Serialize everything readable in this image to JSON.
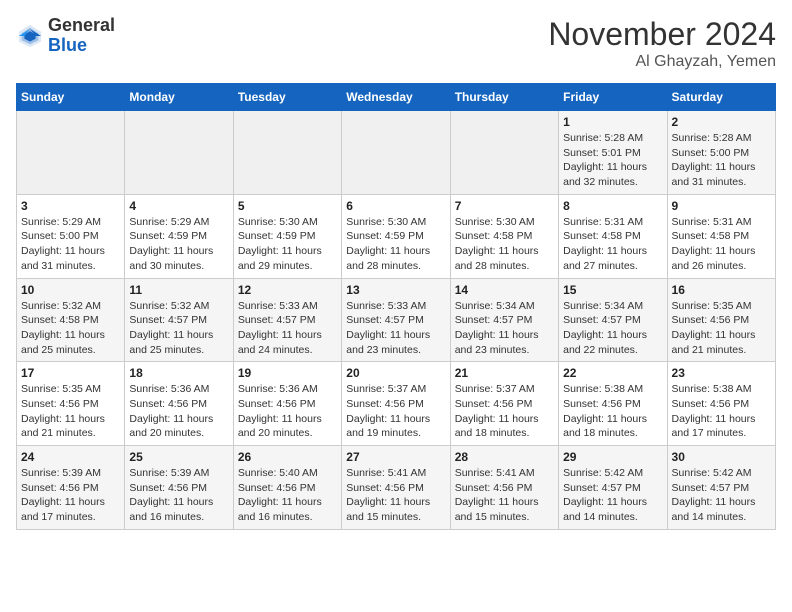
{
  "header": {
    "logo_line1": "General",
    "logo_line2": "Blue",
    "month": "November 2024",
    "location": "Al Ghayzah, Yemen"
  },
  "weekdays": [
    "Sunday",
    "Monday",
    "Tuesday",
    "Wednesday",
    "Thursday",
    "Friday",
    "Saturday"
  ],
  "weeks": [
    [
      {
        "day": "",
        "info": ""
      },
      {
        "day": "",
        "info": ""
      },
      {
        "day": "",
        "info": ""
      },
      {
        "day": "",
        "info": ""
      },
      {
        "day": "",
        "info": ""
      },
      {
        "day": "1",
        "info": "Sunrise: 5:28 AM\nSunset: 5:01 PM\nDaylight: 11 hours\nand 32 minutes."
      },
      {
        "day": "2",
        "info": "Sunrise: 5:28 AM\nSunset: 5:00 PM\nDaylight: 11 hours\nand 31 minutes."
      }
    ],
    [
      {
        "day": "3",
        "info": "Sunrise: 5:29 AM\nSunset: 5:00 PM\nDaylight: 11 hours\nand 31 minutes."
      },
      {
        "day": "4",
        "info": "Sunrise: 5:29 AM\nSunset: 4:59 PM\nDaylight: 11 hours\nand 30 minutes."
      },
      {
        "day": "5",
        "info": "Sunrise: 5:30 AM\nSunset: 4:59 PM\nDaylight: 11 hours\nand 29 minutes."
      },
      {
        "day": "6",
        "info": "Sunrise: 5:30 AM\nSunset: 4:59 PM\nDaylight: 11 hours\nand 28 minutes."
      },
      {
        "day": "7",
        "info": "Sunrise: 5:30 AM\nSunset: 4:58 PM\nDaylight: 11 hours\nand 28 minutes."
      },
      {
        "day": "8",
        "info": "Sunrise: 5:31 AM\nSunset: 4:58 PM\nDaylight: 11 hours\nand 27 minutes."
      },
      {
        "day": "9",
        "info": "Sunrise: 5:31 AM\nSunset: 4:58 PM\nDaylight: 11 hours\nand 26 minutes."
      }
    ],
    [
      {
        "day": "10",
        "info": "Sunrise: 5:32 AM\nSunset: 4:58 PM\nDaylight: 11 hours\nand 25 minutes."
      },
      {
        "day": "11",
        "info": "Sunrise: 5:32 AM\nSunset: 4:57 PM\nDaylight: 11 hours\nand 25 minutes."
      },
      {
        "day": "12",
        "info": "Sunrise: 5:33 AM\nSunset: 4:57 PM\nDaylight: 11 hours\nand 24 minutes."
      },
      {
        "day": "13",
        "info": "Sunrise: 5:33 AM\nSunset: 4:57 PM\nDaylight: 11 hours\nand 23 minutes."
      },
      {
        "day": "14",
        "info": "Sunrise: 5:34 AM\nSunset: 4:57 PM\nDaylight: 11 hours\nand 23 minutes."
      },
      {
        "day": "15",
        "info": "Sunrise: 5:34 AM\nSunset: 4:57 PM\nDaylight: 11 hours\nand 22 minutes."
      },
      {
        "day": "16",
        "info": "Sunrise: 5:35 AM\nSunset: 4:56 PM\nDaylight: 11 hours\nand 21 minutes."
      }
    ],
    [
      {
        "day": "17",
        "info": "Sunrise: 5:35 AM\nSunset: 4:56 PM\nDaylight: 11 hours\nand 21 minutes."
      },
      {
        "day": "18",
        "info": "Sunrise: 5:36 AM\nSunset: 4:56 PM\nDaylight: 11 hours\nand 20 minutes."
      },
      {
        "day": "19",
        "info": "Sunrise: 5:36 AM\nSunset: 4:56 PM\nDaylight: 11 hours\nand 20 minutes."
      },
      {
        "day": "20",
        "info": "Sunrise: 5:37 AM\nSunset: 4:56 PM\nDaylight: 11 hours\nand 19 minutes."
      },
      {
        "day": "21",
        "info": "Sunrise: 5:37 AM\nSunset: 4:56 PM\nDaylight: 11 hours\nand 18 minutes."
      },
      {
        "day": "22",
        "info": "Sunrise: 5:38 AM\nSunset: 4:56 PM\nDaylight: 11 hours\nand 18 minutes."
      },
      {
        "day": "23",
        "info": "Sunrise: 5:38 AM\nSunset: 4:56 PM\nDaylight: 11 hours\nand 17 minutes."
      }
    ],
    [
      {
        "day": "24",
        "info": "Sunrise: 5:39 AM\nSunset: 4:56 PM\nDaylight: 11 hours\nand 17 minutes."
      },
      {
        "day": "25",
        "info": "Sunrise: 5:39 AM\nSunset: 4:56 PM\nDaylight: 11 hours\nand 16 minutes."
      },
      {
        "day": "26",
        "info": "Sunrise: 5:40 AM\nSunset: 4:56 PM\nDaylight: 11 hours\nand 16 minutes."
      },
      {
        "day": "27",
        "info": "Sunrise: 5:41 AM\nSunset: 4:56 PM\nDaylight: 11 hours\nand 15 minutes."
      },
      {
        "day": "28",
        "info": "Sunrise: 5:41 AM\nSunset: 4:56 PM\nDaylight: 11 hours\nand 15 minutes."
      },
      {
        "day": "29",
        "info": "Sunrise: 5:42 AM\nSunset: 4:57 PM\nDaylight: 11 hours\nand 14 minutes."
      },
      {
        "day": "30",
        "info": "Sunrise: 5:42 AM\nSunset: 4:57 PM\nDaylight: 11 hours\nand 14 minutes."
      }
    ]
  ]
}
